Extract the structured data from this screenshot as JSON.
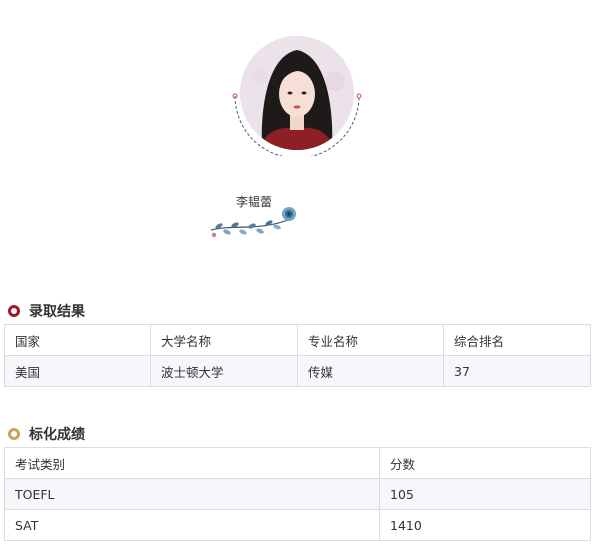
{
  "profile": {
    "name": "李韫蕾"
  },
  "admission": {
    "title": "录取结果",
    "headers": [
      "国家",
      "大学名称",
      "专业名称",
      "综合排名"
    ],
    "rows": [
      [
        "美国",
        "波士顿大学",
        "传媒",
        "37"
      ]
    ]
  },
  "scores": {
    "title": "标化成绩",
    "headers": [
      "考试类别",
      "分数"
    ],
    "rows": [
      [
        "TOEFL",
        "105"
      ],
      [
        "SAT",
        "1410"
      ]
    ]
  },
  "colors": {
    "accent_red": "#9c1b24",
    "accent_gold": "#c7a45a",
    "row_alt": "#f5f7fb",
    "border": "#dcdcdc"
  }
}
